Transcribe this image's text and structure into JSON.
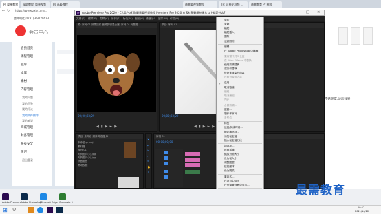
{
  "browser": {
    "tabs": [
      "Pr 简单教程 Home Mouse下载",
      "获取教程_简单视频",
      "Ps 高级教程",
      "最需要视频教程",
      "TP: 可视化视频 ...",
      "最需教育 Pr 视频"
    ],
    "url": "https://www.zxjy.com/..."
  },
  "web": {
    "phone": "咨询电话(0731)-89720623",
    "logo_text": "会员中心",
    "sidebar": [
      {
        "label": "会员首页",
        "sub": false
      },
      {
        "label": "课程管理",
        "sub": false
      },
      {
        "label": "题库",
        "sub": false
      },
      {
        "label": "文库",
        "sub": false
      },
      {
        "label": "素材",
        "sub": false
      },
      {
        "label": "内容管理",
        "sub": false
      },
      {
        "label": "我的问题",
        "sub": true
      },
      {
        "label": "我的回答",
        "sub": true
      },
      {
        "label": "我的评论",
        "sub": true
      },
      {
        "label": "我的文件操作",
        "sub": true,
        "active": true
      },
      {
        "label": "我的笔记",
        "sub": true
      },
      {
        "label": "商城管理",
        "sub": false
      },
      {
        "label": "财务管理",
        "sub": false
      },
      {
        "label": "账号安全",
        "sub": false
      },
      {
        "label": "简记",
        "sub": false
      },
      {
        "label": "退出登录",
        "sub": true
      }
    ],
    "right_text": "不透明度,淡出效果"
  },
  "premiere": {
    "title": "Adobe Premiere Pro 2020 - C:\\用户\\桌面\\最需要视频教程 Premiere Pro 2020 从素材基础调剂像片以上都是什么?",
    "menu": [
      "文件(F)",
      "编辑(E)",
      "剪辑(C)",
      "序列(S)",
      "标记(M)",
      "图形(G)",
      "视图(V)",
      "窗口(W)",
      "帮助(H)"
    ],
    "source_panel_tab": "源: 序列 01  效果控件  音频剪辑混合器: 序列 01  元数据",
    "program_panel_tab": "节目: 序列 01",
    "timecode_source": "00;00;03;29",
    "timecode_program": "00;00;03;29",
    "timecode_timeline": "00;00;00;00",
    "project_tab": "项目: 未命名  媒体浏览器  库",
    "timeline_tab": "序列 01",
    "project_items": [
      "未命名.prproj",
      "素材箱",
      "序列 01",
      "狗狗图片(1).jpg",
      "狗狗图片(2).jpg",
      "调整图层",
      "黑场视频"
    ]
  },
  "context_menu": {
    "items": [
      {
        "label": "剪切",
        "disabled": false
      },
      {
        "label": "复制",
        "disabled": false
      },
      {
        "label": "粘贴",
        "disabled": false
      },
      {
        "label": "粘贴插入",
        "disabled": false
      },
      {
        "label": "删除",
        "disabled": false
      },
      {
        "label": "波纹删除",
        "disabled": false
      },
      {
        "label": "编辑",
        "disabled": false
      },
      {
        "label": "在 Adobe Photoshop 中编辑",
        "disabled": false
      },
      {
        "label": "更改替代时间长度",
        "disabled": true
      },
      {
        "label": "在 After Effects 中替换",
        "disabled": true
      },
      {
        "label": "使用剪辑替换",
        "disabled": false
      },
      {
        "label": "渲染和替换...",
        "disabled": false
      },
      {
        "label": "恢复未渲染的内容",
        "disabled": false
      },
      {
        "label": "还原为原始内容",
        "disabled": true
      },
      {
        "label": "启用",
        "disabled": false
      },
      {
        "label": "取消链接",
        "disabled": false
      },
      {
        "label": "编组",
        "disabled": true
      },
      {
        "label": "取消编组",
        "disabled": true
      },
      {
        "label": "同步",
        "disabled": true
      },
      {
        "label": "合并剪辑...",
        "disabled": true
      },
      {
        "label": "嵌套...",
        "disabled": false
      },
      {
        "label": "制作子序列",
        "disabled": false
      },
      {
        "label": "多机位",
        "disabled": true
      },
      {
        "label": "标签",
        "disabled": false
      },
      {
        "label": "速度/持续时间...",
        "disabled": false
      },
      {
        "label": "帧定格选项...",
        "disabled": false
      },
      {
        "label": "添加帧定格",
        "disabled": false
      },
      {
        "label": "插入帧定格分段",
        "disabled": false
      },
      {
        "label": "场选项...",
        "disabled": false
      },
      {
        "label": "时间插值",
        "disabled": false
      },
      {
        "label": "缩放为帧大小",
        "disabled": false
      },
      {
        "label": "设为帧大小",
        "disabled": false
      },
      {
        "label": "调整图层",
        "disabled": false
      },
      {
        "label": "链接媒体...",
        "disabled": false
      },
      {
        "label": "设为脱机...",
        "disabled": false
      },
      {
        "label": "重命名...",
        "disabled": false
      },
      {
        "label": "在项目中显示",
        "disabled": false
      },
      {
        "label": "在资源管理器中显示...",
        "disabled": false
      },
      {
        "label": "属性",
        "disabled": false
      },
      {
        "label": "显示剪辑关键帧",
        "disabled": false
      }
    ],
    "submenu": [
      "运动",
      "不透明度",
      "时间重映射"
    ],
    "submenu2": [
      "不透明度"
    ]
  },
  "taskbar": {
    "time": "10:57",
    "date": "2021/10/22"
  },
  "watermark": "最需教育",
  "desktop_icons": [
    "Adobe Premiere",
    "Adobe Photoshop",
    "Microsoft Edge",
    "Camtasia 9"
  ]
}
